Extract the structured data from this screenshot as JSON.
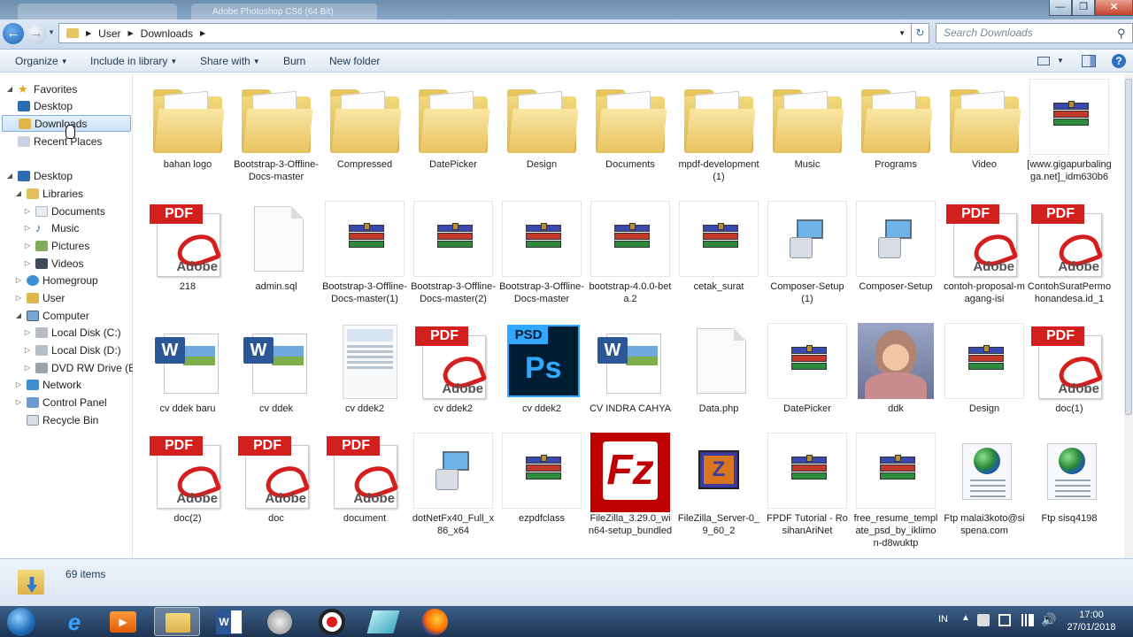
{
  "window": {
    "ghost_tab_text": "Adobe Photoshop CS6 (64 Bit)"
  },
  "address": {
    "path": [
      "User",
      "Downloads"
    ],
    "search_placeholder": "Search Downloads"
  },
  "toolbar": {
    "organize": "Organize",
    "include": "Include in library",
    "share": "Share with",
    "burn": "Burn",
    "new_folder": "New folder"
  },
  "nav": {
    "favorites": "Favorites",
    "desktop_fav": "Desktop",
    "downloads": "Downloads",
    "recent": "Recent Places",
    "desktop": "Desktop",
    "libraries": "Libraries",
    "documents": "Documents",
    "music": "Music",
    "pictures": "Pictures",
    "videos": "Videos",
    "homegroup": "Homegroup",
    "user": "User",
    "computer": "Computer",
    "disk_c": "Local Disk (C:)",
    "disk_d": "Local Disk (D:)",
    "dvd": "DVD RW Drive (E:)",
    "network": "Network",
    "control_panel": "Control Panel",
    "recycle": "Recycle Bin"
  },
  "files": [
    {
      "name": "bahan logo",
      "icon": "folder-icon"
    },
    {
      "name": "Bootstrap-3-Offline-Docs-master",
      "icon": "folder-icon"
    },
    {
      "name": "Compressed",
      "icon": "folder-icon"
    },
    {
      "name": "DatePicker",
      "icon": "folder-icon"
    },
    {
      "name": "Design",
      "icon": "folder-icon"
    },
    {
      "name": "Documents",
      "icon": "folder-icon"
    },
    {
      "name": "mpdf-development(1)",
      "icon": "folder-icon"
    },
    {
      "name": "Music",
      "icon": "folder-icon"
    },
    {
      "name": "Programs",
      "icon": "folder-icon"
    },
    {
      "name": "Video",
      "icon": "folder-icon"
    },
    {
      "name": "[www.gigapurbalingga.net]_idm630b6",
      "icon": "rar-icon"
    },
    {
      "name": "218",
      "icon": "pdf-icon"
    },
    {
      "name": "admin.sql",
      "icon": "blank-file-icon"
    },
    {
      "name": "Bootstrap-3-Offline-Docs-master(1)",
      "icon": "rar-icon"
    },
    {
      "name": "Bootstrap-3-Offline-Docs-master(2)",
      "icon": "rar-icon"
    },
    {
      "name": "Bootstrap-3-Offline-Docs-master",
      "icon": "rar-icon"
    },
    {
      "name": "bootstrap-4.0.0-beta.2",
      "icon": "rar-icon"
    },
    {
      "name": "cetak_surat",
      "icon": "rar-icon"
    },
    {
      "name": "Composer-Setup(1)",
      "icon": "setup-icon"
    },
    {
      "name": "Composer-Setup",
      "icon": "setup-icon"
    },
    {
      "name": "contoh-proposal-magang-isi",
      "icon": "pdf-icon"
    },
    {
      "name": "ContohSuratPermohonandesa.id_1",
      "icon": "pdf-icon"
    },
    {
      "name": "cv ddek baru",
      "icon": "word-icon"
    },
    {
      "name": "cv ddek",
      "icon": "word-icon"
    },
    {
      "name": "cv ddek2",
      "icon": "document-thumbnail-icon"
    },
    {
      "name": "cv ddek2",
      "icon": "pdf-icon"
    },
    {
      "name": "cv ddek2",
      "icon": "photoshop-icon"
    },
    {
      "name": "CV INDRA CAHYA",
      "icon": "word-icon"
    },
    {
      "name": "Data.php",
      "icon": "blank-file-icon"
    },
    {
      "name": "DatePicker",
      "icon": "rar-icon"
    },
    {
      "name": "ddk",
      "icon": "photo-thumbnail-icon"
    },
    {
      "name": "Design",
      "icon": "rar-icon"
    },
    {
      "name": "doc(1)",
      "icon": "pdf-icon"
    },
    {
      "name": "doc(2)",
      "icon": "pdf-icon"
    },
    {
      "name": "doc",
      "icon": "pdf-icon"
    },
    {
      "name": "document",
      "icon": "pdf-icon"
    },
    {
      "name": "dotNetFx40_Full_x86_x64",
      "icon": "setup-icon"
    },
    {
      "name": "ezpdfclass",
      "icon": "rar-icon"
    },
    {
      "name": "FileZilla_3.29.0_win64-setup_bundled",
      "icon": "filezilla-icon"
    },
    {
      "name": "FileZilla_Server-0_9_60_2",
      "icon": "filezilla-server-icon"
    },
    {
      "name": "FPDF Tutorial - RosihanAriNet",
      "icon": "rar-icon"
    },
    {
      "name": "free_resume_template_psd_by_iklimon-d8wuktp",
      "icon": "rar-icon"
    },
    {
      "name": "Ftp malai3koto@sispena.com",
      "icon": "globe-icon"
    },
    {
      "name": "Ftp sisq4198",
      "icon": "globe-icon"
    }
  ],
  "status": {
    "count": "69 items"
  },
  "tray": {
    "lang": "IN",
    "time": "17:00",
    "date": "27/01/2018"
  },
  "colors": {
    "pdf_red": "#d41f1f",
    "word_blue": "#2b5797",
    "ps_blue": "#001d34",
    "filezilla_red": "#bf0000"
  }
}
